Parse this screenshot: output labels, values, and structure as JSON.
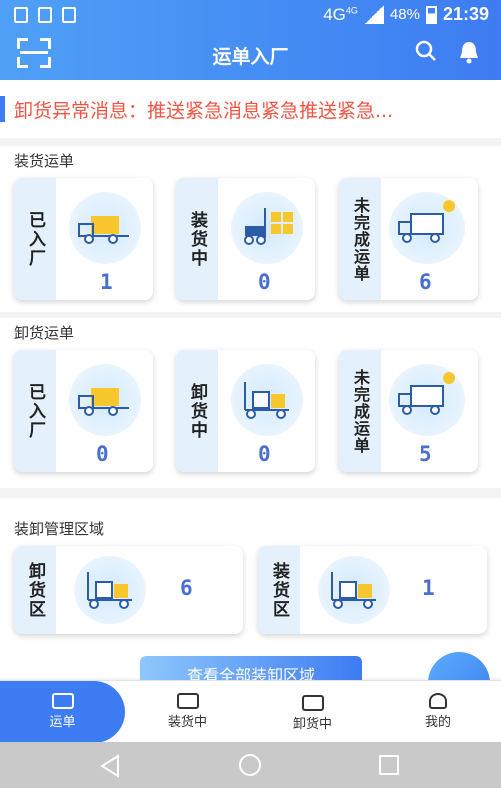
{
  "status": {
    "network": "4G",
    "network_sup": "4G",
    "battery": "48%",
    "time": "21:39"
  },
  "header": {
    "title": "运单入厂",
    "icons": [
      "scan-icon",
      "search-icon",
      "bell-icon"
    ]
  },
  "notice": {
    "text": "卸货异常消息：推送紧急消息紧急推送紧急..."
  },
  "loading": {
    "title": "装货运单",
    "cards": [
      {
        "label": "已入厂",
        "value": "1"
      },
      {
        "label": "装货中",
        "value": "0"
      },
      {
        "label": "未完成运单",
        "value": "6"
      }
    ]
  },
  "unloading": {
    "title": "卸货运单",
    "cards": [
      {
        "label": "已入厂",
        "value": "0"
      },
      {
        "label": "卸货中",
        "value": "0"
      },
      {
        "label": "未完成运单",
        "value": "5"
      }
    ]
  },
  "areas": {
    "title": "装卸管理区域",
    "cards": [
      {
        "label": "卸货区",
        "value": "6"
      },
      {
        "label": "装货区",
        "value": "1"
      }
    ],
    "view_all": "查看全部装卸区域"
  },
  "tabs": [
    {
      "label": "运单"
    },
    {
      "label": "装货中"
    },
    {
      "label": "卸货中"
    },
    {
      "label": "我的"
    }
  ],
  "colors": {
    "primary": "#3d7cf2",
    "alert": "#f05543",
    "side": "#e4f1fd"
  }
}
